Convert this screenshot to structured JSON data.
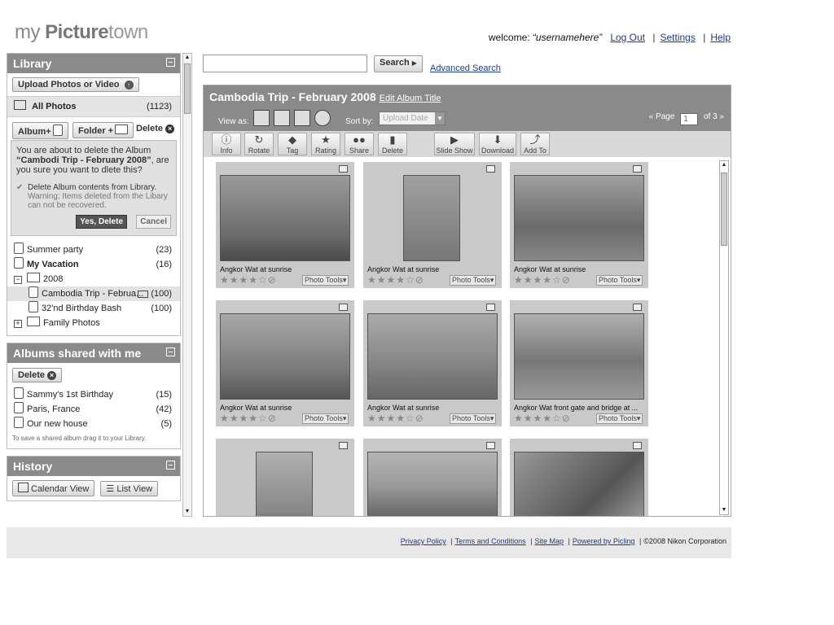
{
  "brand": {
    "my": "my",
    "picture": "Picture",
    "town": "town"
  },
  "topnav": {
    "welcome": "welcome:",
    "username": "“usernamehere”",
    "logout": "Log Out",
    "settings": "Settings",
    "help": "Help"
  },
  "library": {
    "title": "Library",
    "upload": "Upload Photos or Video",
    "all_photos": "All Photos",
    "all_count": "(1123)",
    "tab_album": "Album+",
    "tab_folder": "Folder +",
    "tab_delete": "Delete",
    "confirm_text_1": "You are about to delete the Album",
    "confirm_album": "“Cambodi Trip - February 2008”",
    "confirm_text_2": ", are you sure you want to dlete this?",
    "delete_contents": "Delete Album contents from Library.",
    "warning": "Warning: Items deleted from the Libary can not be recovered.",
    "yes": "Yes, Delete",
    "cancel": "Cancel",
    "items": [
      {
        "label": "Summer party",
        "count": "(23)"
      },
      {
        "label": "My Vacation",
        "count": "(16)"
      },
      {
        "label": "2008",
        "count": ""
      },
      {
        "label": "Cambodia Trip - Februa...",
        "count": "(100)"
      },
      {
        "label": "32'nd Birthday Bash",
        "count": "(100)"
      },
      {
        "label": "Family Photos",
        "count": ""
      }
    ]
  },
  "shared": {
    "title": "Albums shared with me",
    "delete": "Delete",
    "items": [
      {
        "label": "Sammy's 1st Birthday",
        "count": "(15)"
      },
      {
        "label": "Paris, France",
        "count": "(42)"
      },
      {
        "label": "Our new house",
        "count": "(5)"
      }
    ],
    "hint": "To save a shared album drag it to your Library."
  },
  "history": {
    "title": "History",
    "calendar": "Calendar View",
    "list": "List View"
  },
  "search": {
    "placeholder": "",
    "button": "Search",
    "advanced": "Advanced Search"
  },
  "album": {
    "title": "Cambodia Trip - February 2008",
    "edit": "Edit Album Title",
    "view_as": "View as:",
    "sort_by": "Sort by:",
    "sort_value": "Upload Date",
    "page_label": "Page",
    "page": "1",
    "of": "of 3"
  },
  "tools": [
    "Info",
    "Rotate",
    "Tag",
    "Rating",
    "Share",
    "Delete",
    "Slide Show",
    "Download",
    "Add To"
  ],
  "photos": [
    {
      "caption": "Angkor Wat at sunrise",
      "rating": 4
    },
    {
      "caption": "Angkor Wat at sunrise",
      "rating": 4
    },
    {
      "caption": "Angkor Wat at sunrise",
      "rating": 4
    },
    {
      "caption": "Angkor Wat at sunrise",
      "rating": 4
    },
    {
      "caption": "Angkor Wat at sunrise",
      "rating": 4
    },
    {
      "caption": "Angkor Wat front gate and bridge at ...",
      "rating": 4
    },
    {
      "caption": "",
      "rating": 0
    },
    {
      "caption": "",
      "rating": 0
    },
    {
      "caption": "",
      "rating": 0
    }
  ],
  "photo_tools": "Photo Tools",
  "footer": {
    "privacy": "Privacy Policy",
    "terms": "Terms and Conditions",
    "sitemap": "Site Map",
    "powered": "Powered by Picling",
    "copyright": "©2008 Nikon Corporation"
  }
}
